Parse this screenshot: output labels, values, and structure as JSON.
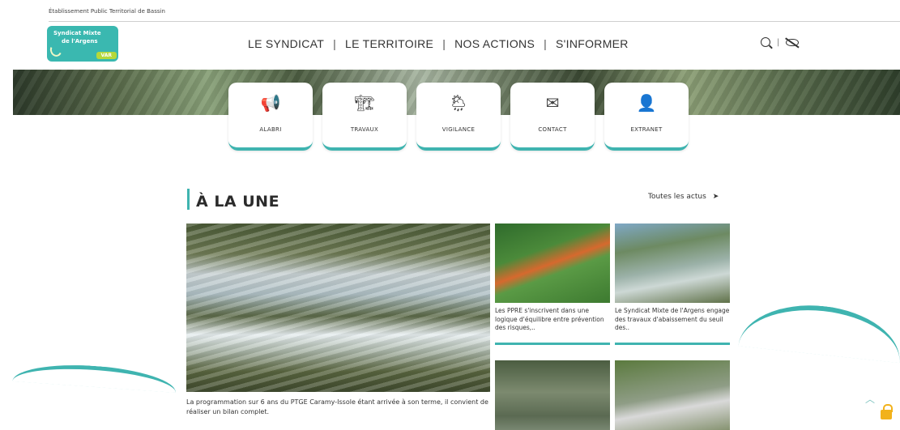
{
  "header": {
    "top_label": "Établissement Public Territorial de Bassin",
    "logo": {
      "line1": "Syndicat Mixte",
      "line2": "de l'Argens",
      "badge": "VAR"
    },
    "nav": [
      "LE SYNDICAT",
      "LE TERRITOIRE",
      "NOS ACTIONS",
      "S'INFORMER"
    ],
    "nav_separator": "|",
    "tools_separator": "|"
  },
  "quick_links": [
    {
      "label": "ALABRI",
      "icon": "megaphone-icon",
      "glyph": "📢"
    },
    {
      "label": "TRAVAUX",
      "icon": "construction-icon",
      "glyph": "🏗"
    },
    {
      "label": "VIGILANCE",
      "icon": "weather-icon",
      "glyph": "🌦"
    },
    {
      "label": "CONTACT",
      "icon": "mail-icon",
      "glyph": "✉"
    },
    {
      "label": "EXTRANET",
      "icon": "user-icon",
      "glyph": "👤"
    }
  ],
  "news": {
    "title": "À LA UNE",
    "all_link": "Toutes les actus",
    "arrow": "➤",
    "feature_caption": "La programmation sur 6 ans du PTGE Caramy-Issole étant arrivée à son terme, il convient de réaliser un bilan complet.",
    "cards": [
      {
        "caption": "Les PPRE s'inscrivent dans une logique d'équilibre entre prévention des risques,.."
      },
      {
        "caption": "Le Syndicat Mixte de l'Argens engage des travaux d'abaissement du seuil des.."
      },
      {
        "caption": ""
      },
      {
        "caption": ""
      }
    ]
  },
  "colors": {
    "accent": "#3fb4b0",
    "logo_bg": "#3ab8b0",
    "lock": "#f2b21b"
  },
  "misc": {
    "scroll_up": "︿"
  }
}
